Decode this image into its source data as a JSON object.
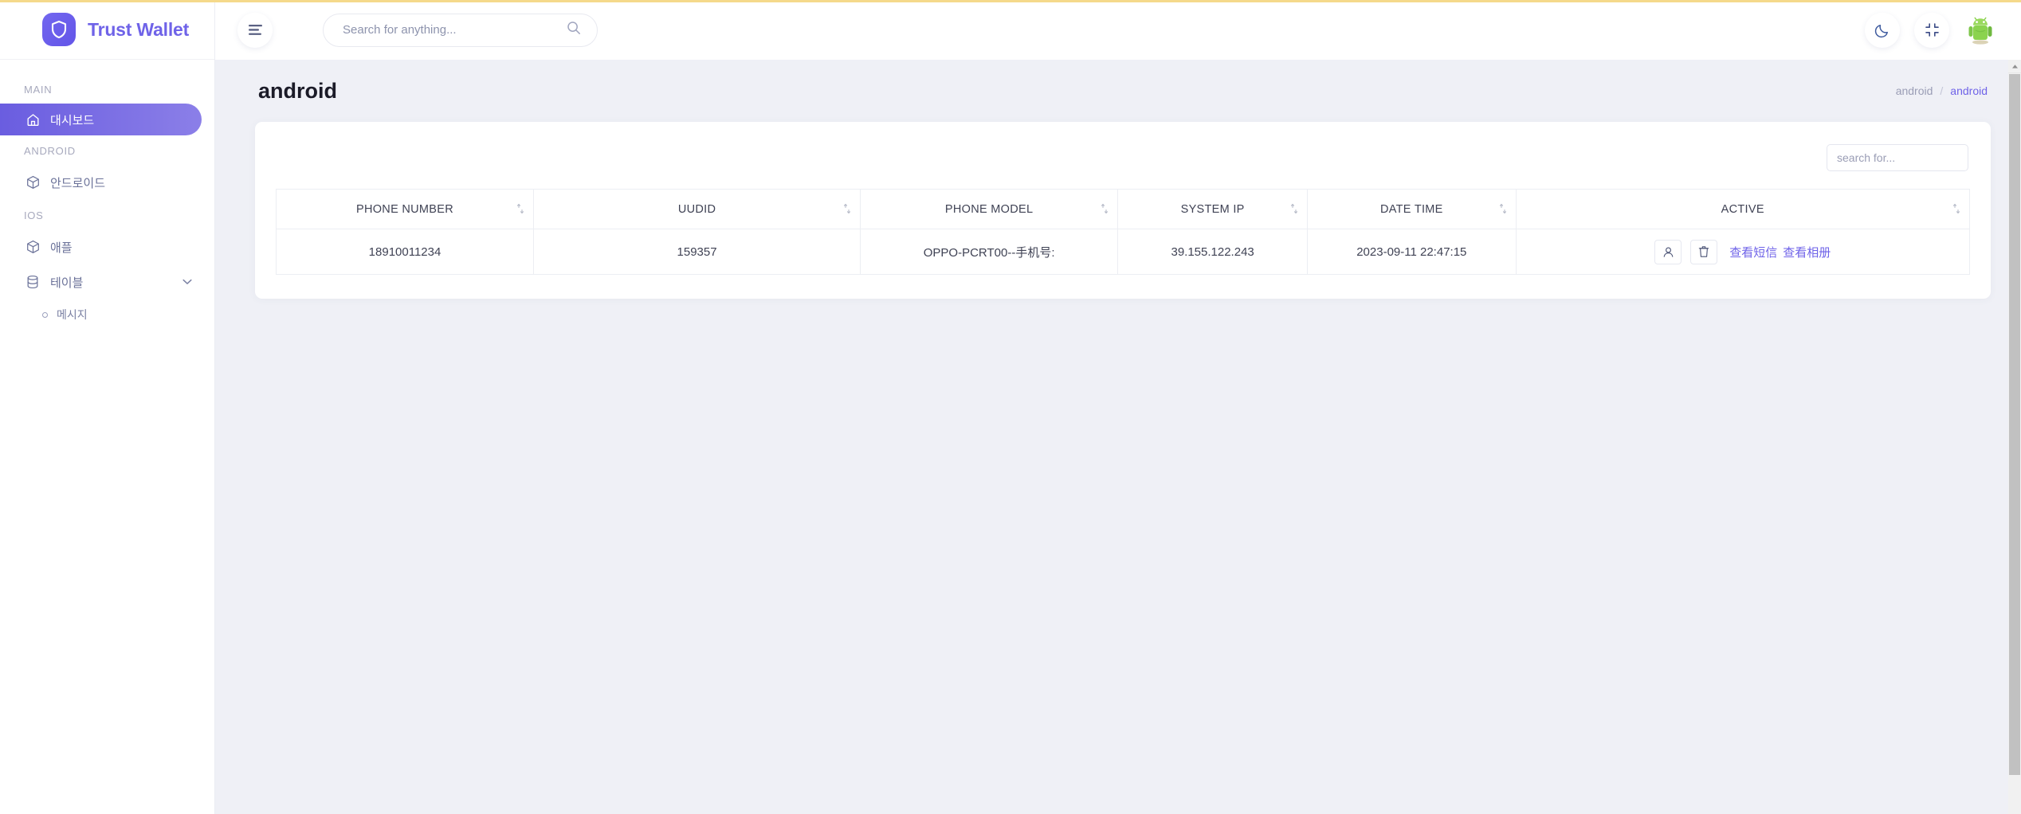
{
  "brand": {
    "name": "Trust Wallet",
    "logo_icon": "shield-icon",
    "logo_color": "#6f63e8"
  },
  "header": {
    "menu_icon": "hamburger-menu-icon",
    "search": {
      "placeholder": "Search for anything...",
      "value": "",
      "icon": "search-icon"
    },
    "dark_mode_icon": "moon-icon",
    "fullscreen_icon": "compress-icon",
    "avatar_icon": "android-robot-avatar"
  },
  "sidebar": {
    "sections": [
      {
        "caption": "MAIN",
        "items": [
          {
            "label": "대시보드",
            "icon": "home-icon",
            "active": true
          }
        ]
      },
      {
        "caption": "ANDROID",
        "items": [
          {
            "label": "안드로이드",
            "icon": "box-icon",
            "active": false
          }
        ]
      },
      {
        "caption": "IOS",
        "items": [
          {
            "label": "애플",
            "icon": "box-icon",
            "active": false
          },
          {
            "label": "테이블",
            "icon": "database-icon",
            "active": false,
            "expandable": true,
            "chevron": "chevron-down-icon"
          }
        ]
      }
    ],
    "sub_items": [
      {
        "label": "메시지"
      }
    ]
  },
  "page": {
    "title": "android",
    "breadcrumb": {
      "root": "android",
      "separator": "/",
      "current": "android"
    }
  },
  "table": {
    "search": {
      "placeholder": "search for...",
      "value": ""
    },
    "sort_icon": "sort-updown-icon",
    "columns": [
      "PHONE NUMBER",
      "UUDID",
      "PHONE MODEL",
      "SYSTEM IP",
      "DATE TIME",
      "ACTIVE"
    ],
    "rows": [
      {
        "phone_number": "18910011234",
        "uudid": "159357",
        "phone_model": "OPPO-PCRT00--手机号:",
        "system_ip": "39.155.122.243",
        "date_time": "2023-09-11 22:47:15",
        "actions": {
          "user_icon": "user-icon",
          "delete_icon": "trash-icon",
          "links": [
            "查看短信",
            "查看相册"
          ]
        }
      }
    ]
  },
  "colors": {
    "accent": "#6f63e8",
    "accent_gradient_start": "#6a5de0",
    "accent_gradient_end": "#8b7fe8",
    "page_bg": "#eff0f6",
    "top_strip": "#f5d98b",
    "text_dark": "#1b1b28",
    "text_muted": "#9a9db5"
  },
  "scrollbar": {
    "up_arrow_icon": "caret-up-icon"
  }
}
